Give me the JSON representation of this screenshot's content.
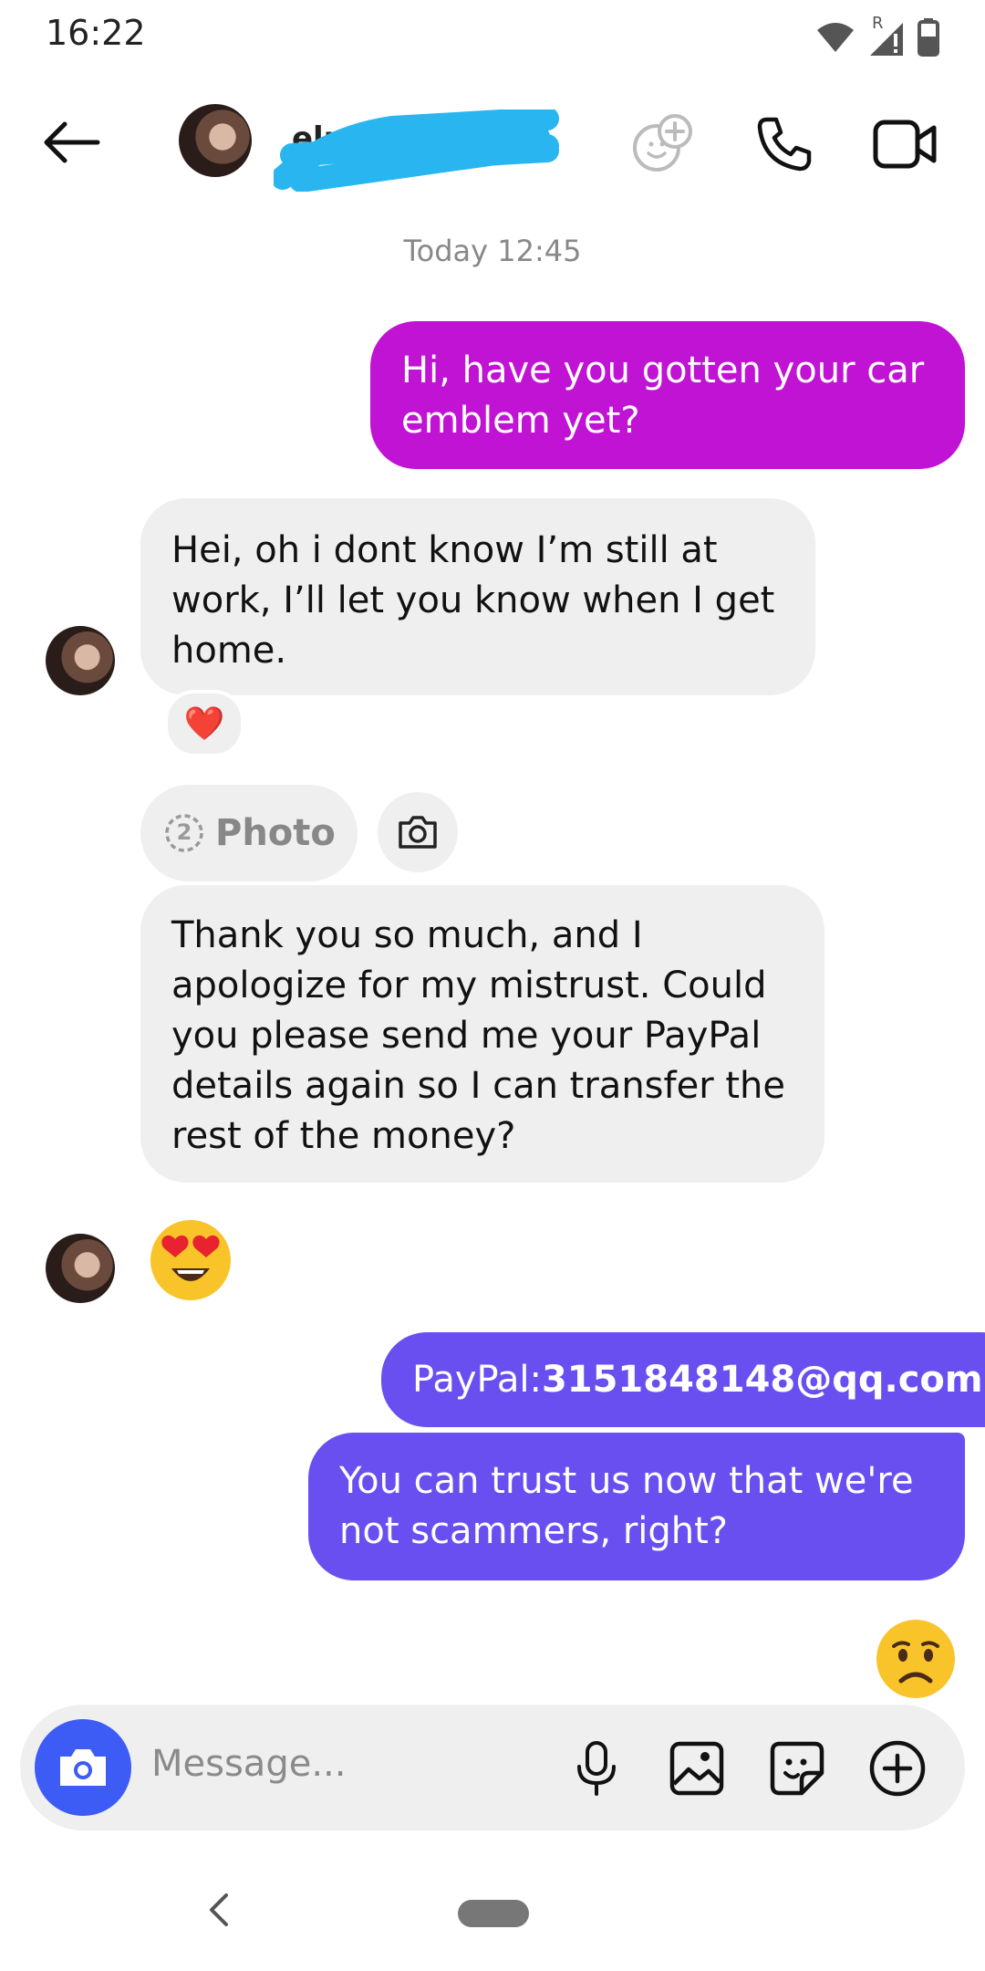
{
  "status_bar": {
    "time": "16:22",
    "roaming": "R"
  },
  "header": {
    "contact_name": "elr"
  },
  "conversation": {
    "timestamp": "Today 12:45",
    "msg_out_1": "Hi, have you gotten your car emblem yet?",
    "msg_in_1": "Hei, oh i dont know I’m still at work, I’ll let you know when I get home.",
    "reaction_1": "❤️",
    "photo_label": "Photo",
    "photo_count": "2",
    "msg_in_2": "Thank you so much, and I apologize for my mistrust. Could you please send me your PayPal details again so I can transfer the rest of the money?",
    "msg_out_2_prefix": "PayPal:",
    "msg_out_2_email": "3151848148@qq.com",
    "msg_out_3": "You can trust us now that we're not scammers, right?"
  },
  "composer": {
    "placeholder": "Message..."
  },
  "colors": {
    "outgoing_magenta": "#c013d4",
    "outgoing_purple": "#6a4ff0",
    "incoming_gray": "#efeff0",
    "composer_camera": "#3d5bf5"
  }
}
